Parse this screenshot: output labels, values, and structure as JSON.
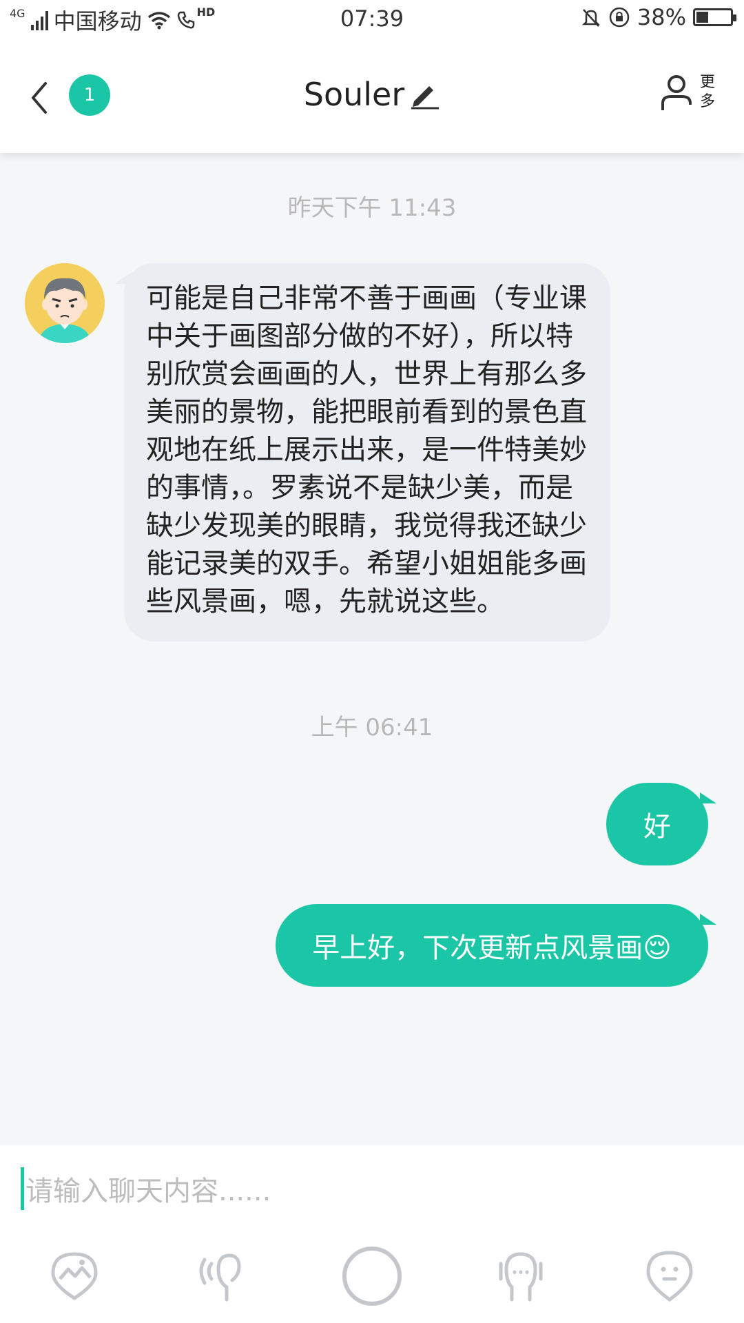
{
  "status_bar": {
    "network": "4G",
    "carrier": "中国移动",
    "hd": "HD",
    "time": "07:39",
    "battery_text": "38%",
    "battery_level": 0.38
  },
  "header": {
    "unread_count": "1",
    "title": "Souler"
  },
  "more": {
    "line1": "更",
    "line2": "多"
  },
  "chat": {
    "timestamp_1": "昨天下午 11:43",
    "incoming_text": "可能是自己非常不善于画画（专业课中关于画图部分做的不好），所以特别欣赏会画画的人，世界上有那么多美丽的景物，能把眼前看到的景色直观地在纸上展示出来，是一件特美妙的事情，。罗素说不是缺少美，而是缺少发现美的眼睛，我觉得我还缺少能记录美的双手。希望小姐姐能多画些风景画，嗯，先就说这些。",
    "timestamp_2": "上午 06:41",
    "outgoing_1": "好",
    "outgoing_2": "早上好，下次更新点风景画😌"
  },
  "input": {
    "placeholder": "请输入聊天内容......"
  },
  "colors": {
    "accent": "#1bc6a6",
    "incoming_bubble": "#eaedf1",
    "background": "#f5f6f8",
    "icon_gray": "#c4c8cd"
  },
  "icons": [
    "back-arrow-icon",
    "edit-pencil-icon",
    "person-icon",
    "image-icon",
    "voice-icon",
    "circle-icon",
    "mic-icon",
    "emoji-icon"
  ]
}
